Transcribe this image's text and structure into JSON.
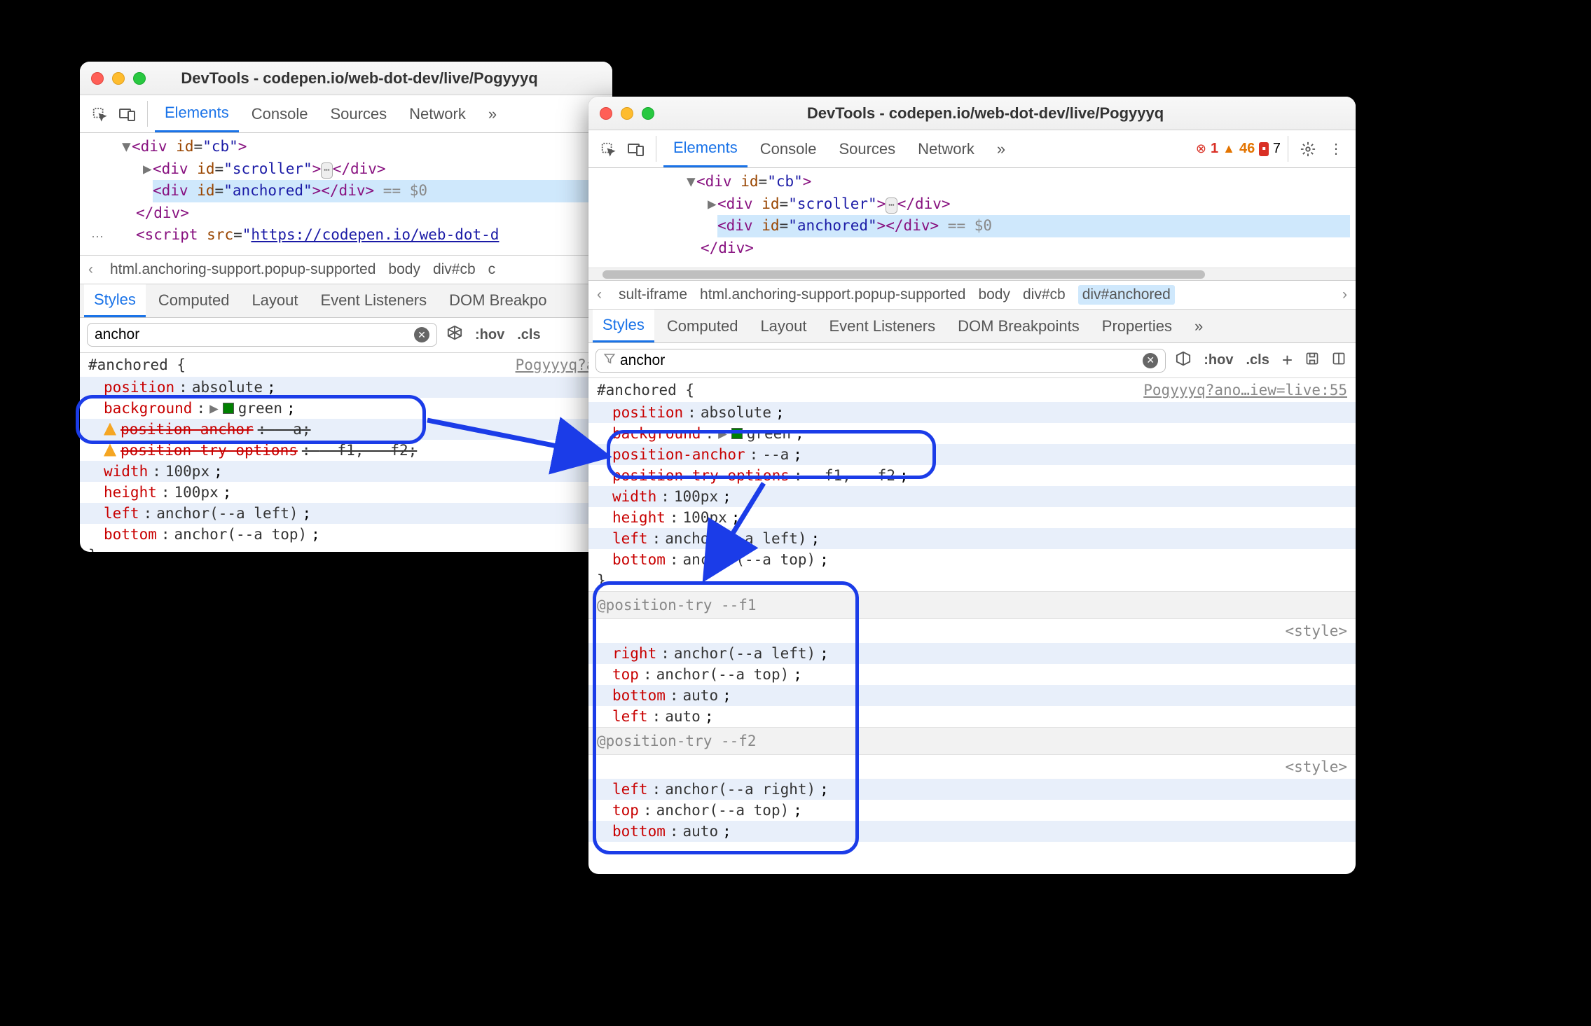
{
  "title": "DevTools - codepen.io/web-dot-dev/live/Pogyyyq",
  "tabs": {
    "elements": "Elements",
    "console": "Console",
    "sources": "Sources",
    "network": "Network"
  },
  "status": {
    "errors": "1",
    "warnings": "46",
    "issues": "7"
  },
  "dom": {
    "cb_open": "<div id=\"cb\">",
    "scroller": "<div id=\"scroller\">",
    "scroller_close": "</div>",
    "anchored": "<div id=\"anchored\">",
    "anchored_close": "</div>",
    "close_div": "</div>",
    "eq0": "== $0",
    "script_open": "<script src=\"",
    "script_url": "https://codepen.io/web-dot-d",
    "ellip": "…"
  },
  "crumbs": {
    "sult_iframe": "sult-iframe",
    "html": "html.anchoring-support.popup-supported",
    "body": "body",
    "divcb": "div#cb",
    "divanchored": "div#anchored"
  },
  "subtabs": {
    "styles": "Styles",
    "computed": "Computed",
    "layout": "Layout",
    "listeners": "Event Listeners",
    "dombp": "DOM Breakpoints",
    "dombp_short": "DOM Breakpo",
    "properties": "Properties"
  },
  "filter": {
    "value": "anchor",
    "hov": ":hov",
    "cls": ".cls"
  },
  "rule1": {
    "selector": "#anchored {",
    "src_left": "Pogyyyq?an",
    "src_right": "Pogyyyq?ano…iew=live:55",
    "decls": [
      {
        "prop": "position",
        "val": "absolute",
        "warn": false,
        "strike": false
      },
      {
        "prop": "background",
        "val": "green",
        "swatch": true,
        "tri": true,
        "warn": false,
        "strike": false
      },
      {
        "prop": "position-anchor",
        "val": "--a",
        "warn": true,
        "strike": true
      },
      {
        "prop": "position-try-options",
        "val": "--f1, --f2",
        "warn": true,
        "strike": true
      },
      {
        "prop": "width",
        "val": "100px",
        "warn": false,
        "strike": false
      },
      {
        "prop": "height",
        "val": "100px",
        "warn": false,
        "strike": false
      },
      {
        "prop": "left",
        "val": "anchor(--a left)",
        "warn": false,
        "strike": false
      },
      {
        "prop": "bottom",
        "val": "anchor(--a top)",
        "warn": false,
        "strike": false
      }
    ]
  },
  "pos_f1": {
    "header": "@position-try --f1",
    "style_link": "<style>",
    "decls": [
      {
        "prop": "right",
        "val": "anchor(--a left)"
      },
      {
        "prop": "top",
        "val": "anchor(--a top)"
      },
      {
        "prop": "bottom",
        "val": "auto"
      },
      {
        "prop": "left",
        "val": "auto"
      }
    ]
  },
  "pos_f2": {
    "header": "@position-try --f2",
    "style_link": "<style>",
    "decls": [
      {
        "prop": "left",
        "val": "anchor(--a right)"
      },
      {
        "prop": "top",
        "val": "anchor(--a top)"
      },
      {
        "prop": "bottom",
        "val": "auto"
      }
    ]
  }
}
